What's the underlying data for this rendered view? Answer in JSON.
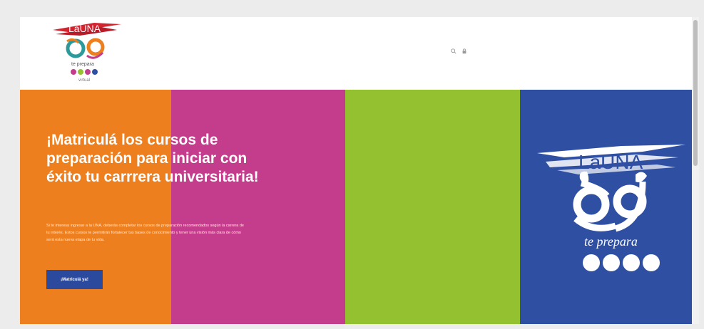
{
  "brand": {
    "logo_text": "LaUNA",
    "logo_tagline": "te prepara",
    "logo_sub": "virtual"
  },
  "header": {
    "icons": [
      "search-icon",
      "lock-icon"
    ]
  },
  "hero": {
    "title": "¡Matriculá los cursos de preparación para iniciar con éxito tu carrrera universitaria!",
    "text": "Si te interesa ingresar a la UNA, deberás completar los cursos de preparación recomendados según la carrera de tu interés. Estos cursos te permitirán fortalecer tus bases de conocimiento y tener una visión más clara de cómo será esta nueva etapa de tu vida.",
    "button_label": "¡Matriculá ya!"
  },
  "colors": {
    "orange": "#ee7f1f",
    "magenta": "#c43d8c",
    "green": "#93c12f",
    "blue": "#2e4fa2",
    "button": "#2b4a9e"
  }
}
